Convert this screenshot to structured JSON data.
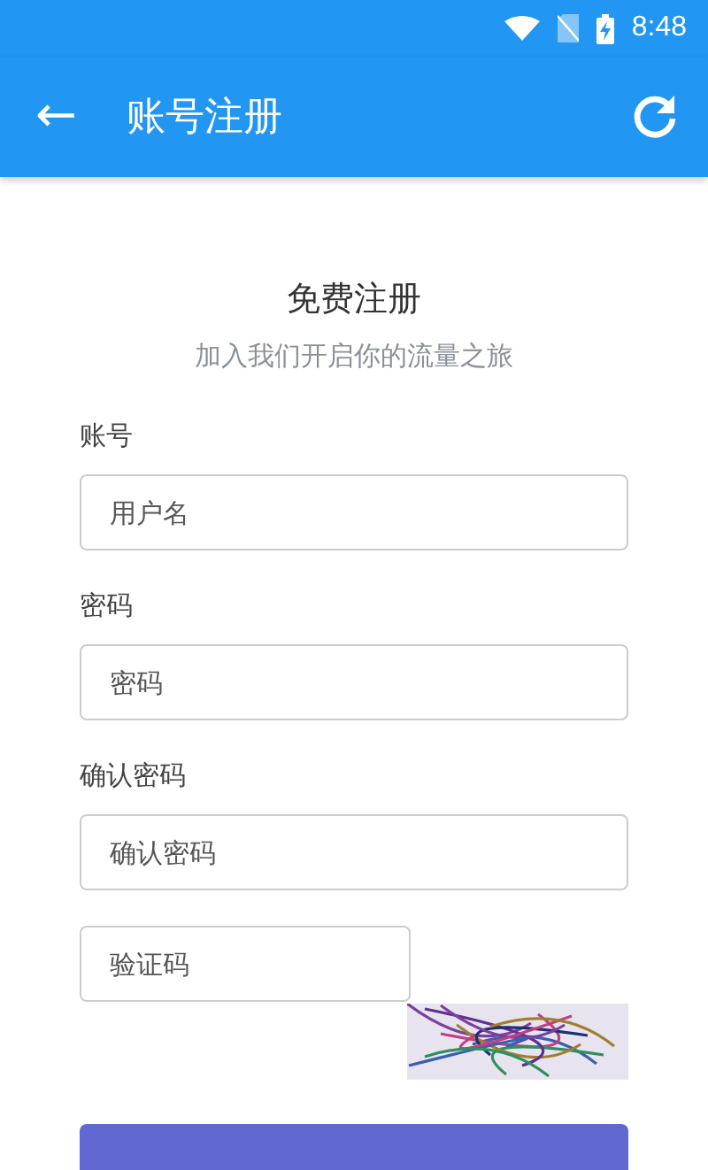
{
  "status_bar": {
    "time": "8:48"
  },
  "toolbar": {
    "back_glyph": "←",
    "title": "账号注册"
  },
  "form": {
    "title": "免费注册",
    "subtitle": "加入我们开启你的流量之旅",
    "fields": [
      {
        "label": "账号",
        "placeholder": "用户名"
      },
      {
        "label": "密码",
        "placeholder": "密码"
      },
      {
        "label": "确认密码",
        "placeholder": "确认密码"
      }
    ],
    "captcha": {
      "placeholder": "验证码"
    }
  }
}
